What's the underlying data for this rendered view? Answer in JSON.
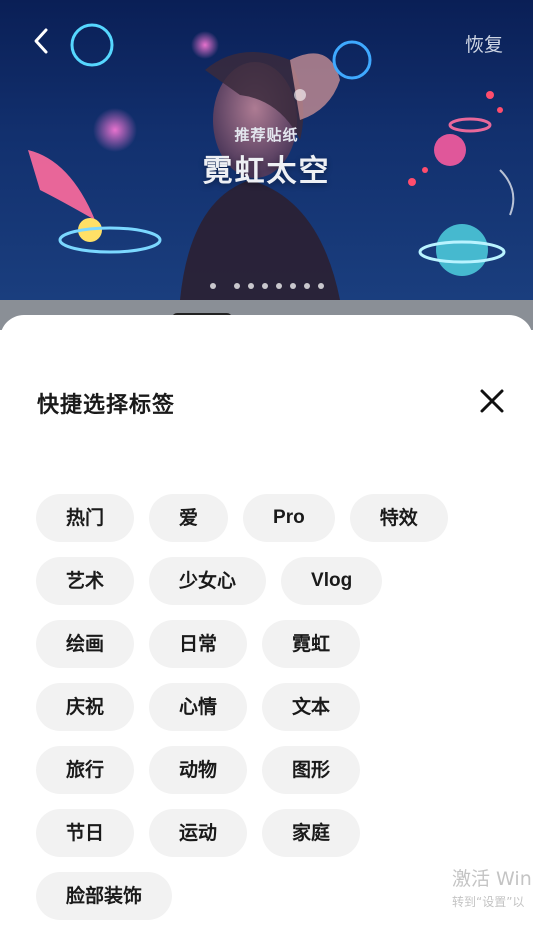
{
  "header": {
    "back_icon": "chevron-left-icon",
    "restore_label": "恢复"
  },
  "banner": {
    "subtitle": "推荐贴纸",
    "title": "霓虹太空",
    "page_count": 8,
    "active_page": 1
  },
  "sheet": {
    "title": "快捷选择标签",
    "close_icon": "close-icon",
    "tag_rows": [
      [
        "热门",
        "爱",
        "Pro",
        "特效"
      ],
      [
        "艺术",
        "少女心",
        "Vlog"
      ],
      [
        "绘画",
        "日常",
        "霓虹"
      ],
      [
        "庆祝",
        "心情",
        "文本"
      ],
      [
        "旅行",
        "动物",
        "图形"
      ],
      [
        "节日",
        "运动",
        "家庭"
      ],
      [
        "脸部装饰"
      ]
    ]
  },
  "watermark": {
    "line1": "激活 Win",
    "line2": "转到“设置”以"
  }
}
